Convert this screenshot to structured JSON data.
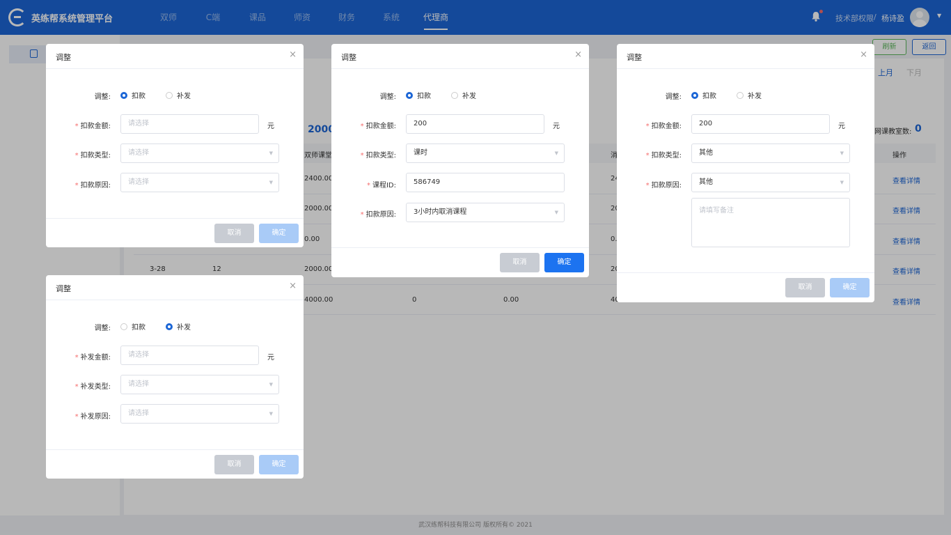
{
  "header": {
    "app_title": "英练帮系统管理平台",
    "nav": [
      "双师",
      "C端",
      "课品",
      "师资",
      "财务",
      "系统",
      "代理商"
    ],
    "active_nav_index": 6,
    "user_dept": "技术部权限",
    "separator": "/",
    "user_name": "杨诗盈"
  },
  "toolbar": {
    "refresh": "刷新",
    "back": "返回",
    "prev_month": "上月",
    "next_month": "下月"
  },
  "summary": {
    "big_value": "2000",
    "net_classrooms_label": "网课教室数:",
    "net_classrooms_value": "0"
  },
  "table": {
    "columns": [
      "双师课堂",
      "消",
      "操作"
    ],
    "rows": [
      {
        "c1": "",
        "c2": "",
        "c3": "2400.00",
        "c4": "",
        "c5": "",
        "c6": "24",
        "action": "查看详情"
      },
      {
        "c1": "",
        "c2": "",
        "c3": "2000.00",
        "c4": "",
        "c5": "",
        "c6": "20",
        "action": "查看详情"
      },
      {
        "c1": "",
        "c2": "",
        "c3": "0.00",
        "c4": "",
        "c5": "",
        "c6": "0.",
        "action": "查看详情"
      },
      {
        "c1": "3-28",
        "c2": "12",
        "c3": "2000.00",
        "c4": "",
        "c5": "",
        "c6": "20",
        "action": "查看详情"
      },
      {
        "c1": "",
        "c2": "",
        "c3": "4000.00",
        "c4": "0",
        "c5": "0.00",
        "c6": "40",
        "action": "查看详情"
      }
    ]
  },
  "footer": "武汉练帮科技有限公司 版权所有© 2021",
  "dialogs": {
    "d1": {
      "title": "调整",
      "adjust_label": "调整:",
      "opt_deduct": "扣款",
      "opt_reissue": "补发",
      "amount_label": "扣款金额:",
      "amount_placeholder": "请选择",
      "unit": "元",
      "type_label": "扣款类型:",
      "type_placeholder": "请选择",
      "reason_label": "扣款原因:",
      "reason_placeholder": "请选择",
      "cancel": "取消",
      "ok": "确定"
    },
    "d2": {
      "title": "调整",
      "adjust_label": "调整:",
      "opt_deduct": "扣款",
      "opt_reissue": "补发",
      "amount_label": "扣款金额:",
      "amount_value": "200",
      "unit": "元",
      "type_label": "扣款类型:",
      "type_value": "课时",
      "course_label": "课程ID:",
      "course_value": "586749",
      "reason_label": "扣款原因:",
      "reason_value": "3小时内取消课程",
      "cancel": "取消",
      "ok": "确定"
    },
    "d3": {
      "title": "调整",
      "adjust_label": "调整:",
      "opt_deduct": "扣款",
      "opt_reissue": "补发",
      "amount_label": "扣款金额:",
      "amount_value": "200",
      "unit": "元",
      "type_label": "扣款类型:",
      "type_value": "其他",
      "reason_label": "扣款原因:",
      "reason_value": "其他",
      "remark_placeholder": "请填写备注",
      "cancel": "取消",
      "ok": "确定"
    },
    "d4": {
      "title": "调整",
      "adjust_label": "调整:",
      "opt_deduct": "扣款",
      "opt_reissue": "补发",
      "amount_label": "补发金额:",
      "amount_placeholder": "请选择",
      "unit": "元",
      "type_label": "补发类型:",
      "type_placeholder": "请选择",
      "reason_label": "补发原因:",
      "reason_placeholder": "请选择",
      "cancel": "取消",
      "ok": "确定"
    }
  }
}
